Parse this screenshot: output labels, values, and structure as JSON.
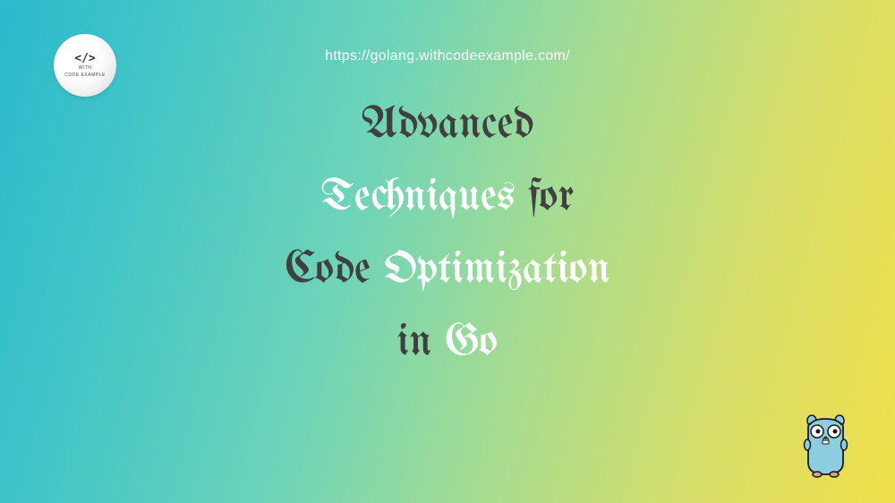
{
  "logo": {
    "code_symbol": "</>",
    "text_line1": "WITH",
    "text_line2": "CODE EXAMPLE"
  },
  "url": "https://golang.withcodeexample.com/",
  "title": {
    "line1_word1": "Advanced",
    "line2_word1": "Techniques",
    "line2_word2": "for",
    "line3_word1": "Code",
    "line3_word2": "Optimization",
    "line4_word1": "in",
    "line4_word2": "Go"
  },
  "mascot_name": "go-gopher"
}
